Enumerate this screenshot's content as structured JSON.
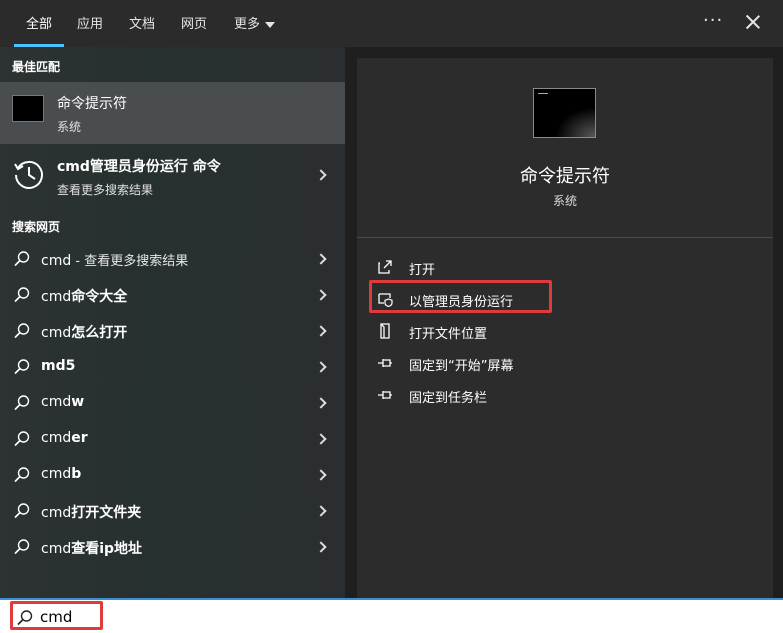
{
  "tabs": [
    {
      "label": "全部",
      "active": true
    },
    {
      "label": "应用"
    },
    {
      "label": "文档"
    },
    {
      "label": "网页"
    },
    {
      "label": "更多"
    }
  ],
  "icons": {
    "more": "more-options-icon",
    "close": "close-icon",
    "search": "search-icon"
  },
  "colors": {
    "accent": "#4cc2ff",
    "highlight": "#e03b3b"
  },
  "best_match": {
    "header": "最佳匹配",
    "title": "命令提示符",
    "subtitle": "系统"
  },
  "history_item": {
    "title": "cmd管理员身份运行 命令",
    "subtitle": "查看更多搜索结果"
  },
  "web_search": {
    "header": "搜索网页",
    "items": [
      {
        "prefix": "cmd",
        "suffix": " - 查看更多搜索结果"
      },
      {
        "prefix": "cmd",
        "bold": "命令大全"
      },
      {
        "prefix": "cmd",
        "bold": "怎么打开"
      },
      {
        "prefix": "",
        "bold": "md5"
      },
      {
        "prefix": "cmd",
        "bold": "w"
      },
      {
        "prefix": "cmd",
        "bold": "er"
      },
      {
        "prefix": "cmd",
        "bold": "b"
      },
      {
        "prefix": "cmd",
        "bold": "打开文件夹"
      },
      {
        "prefix": "cmd",
        "bold": "查看ip地址"
      }
    ]
  },
  "preview": {
    "title": "命令提示符",
    "subtitle": "系统",
    "actions": [
      {
        "label": "打开",
        "icon": "open-icon"
      },
      {
        "label": "以管理员身份运行",
        "icon": "shield-icon"
      },
      {
        "label": "打开文件位置",
        "icon": "file-location-icon"
      },
      {
        "label": "固定到“开始”屏幕",
        "icon": "pin-icon"
      },
      {
        "label": "固定到任务栏",
        "icon": "pin-icon"
      }
    ]
  },
  "search": {
    "value": "cmd"
  }
}
